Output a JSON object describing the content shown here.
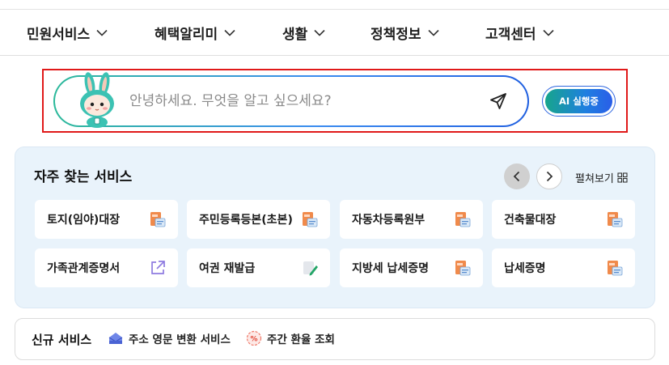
{
  "nav": {
    "items": [
      {
        "label": "민원서비스"
      },
      {
        "label": "혜택알리미"
      },
      {
        "label": "생활"
      },
      {
        "label": "정책정보"
      },
      {
        "label": "고객센터"
      }
    ]
  },
  "search": {
    "placeholder": "안녕하세요. 무엇을 알고 싶으세요?",
    "value": "",
    "ai_button_label": "AI 실행중"
  },
  "frequent": {
    "title": "자주 찾는 서비스",
    "expand_label": "펼쳐보기",
    "services": [
      {
        "label": "토지(임야)대장",
        "icon": "pdf-document-icon"
      },
      {
        "label": "주민등록등본(초본)",
        "icon": "pdf-document-icon"
      },
      {
        "label": "자동차등록원부",
        "icon": "pdf-document-icon"
      },
      {
        "label": "건축물대장",
        "icon": "pdf-document-icon"
      },
      {
        "label": "가족관계증명서",
        "icon": "external-link-icon"
      },
      {
        "label": "여권 재발급",
        "icon": "edit-document-icon"
      },
      {
        "label": "지방세 납세증명",
        "icon": "pdf-document-icon"
      },
      {
        "label": "납세증명",
        "icon": "pdf-document-icon"
      }
    ]
  },
  "new_services": {
    "title": "신규 서비스",
    "items": [
      {
        "label": "주소 영문 변환 서비스",
        "icon": "mailbox-icon"
      },
      {
        "label": "주간 환율 조회",
        "icon": "percent-tag-icon"
      }
    ]
  },
  "colors": {
    "accent_blue": "#2f67e0",
    "accent_teal": "#17a58c",
    "panel_bg": "#e9f3fb",
    "highlight_red": "#e01919"
  }
}
